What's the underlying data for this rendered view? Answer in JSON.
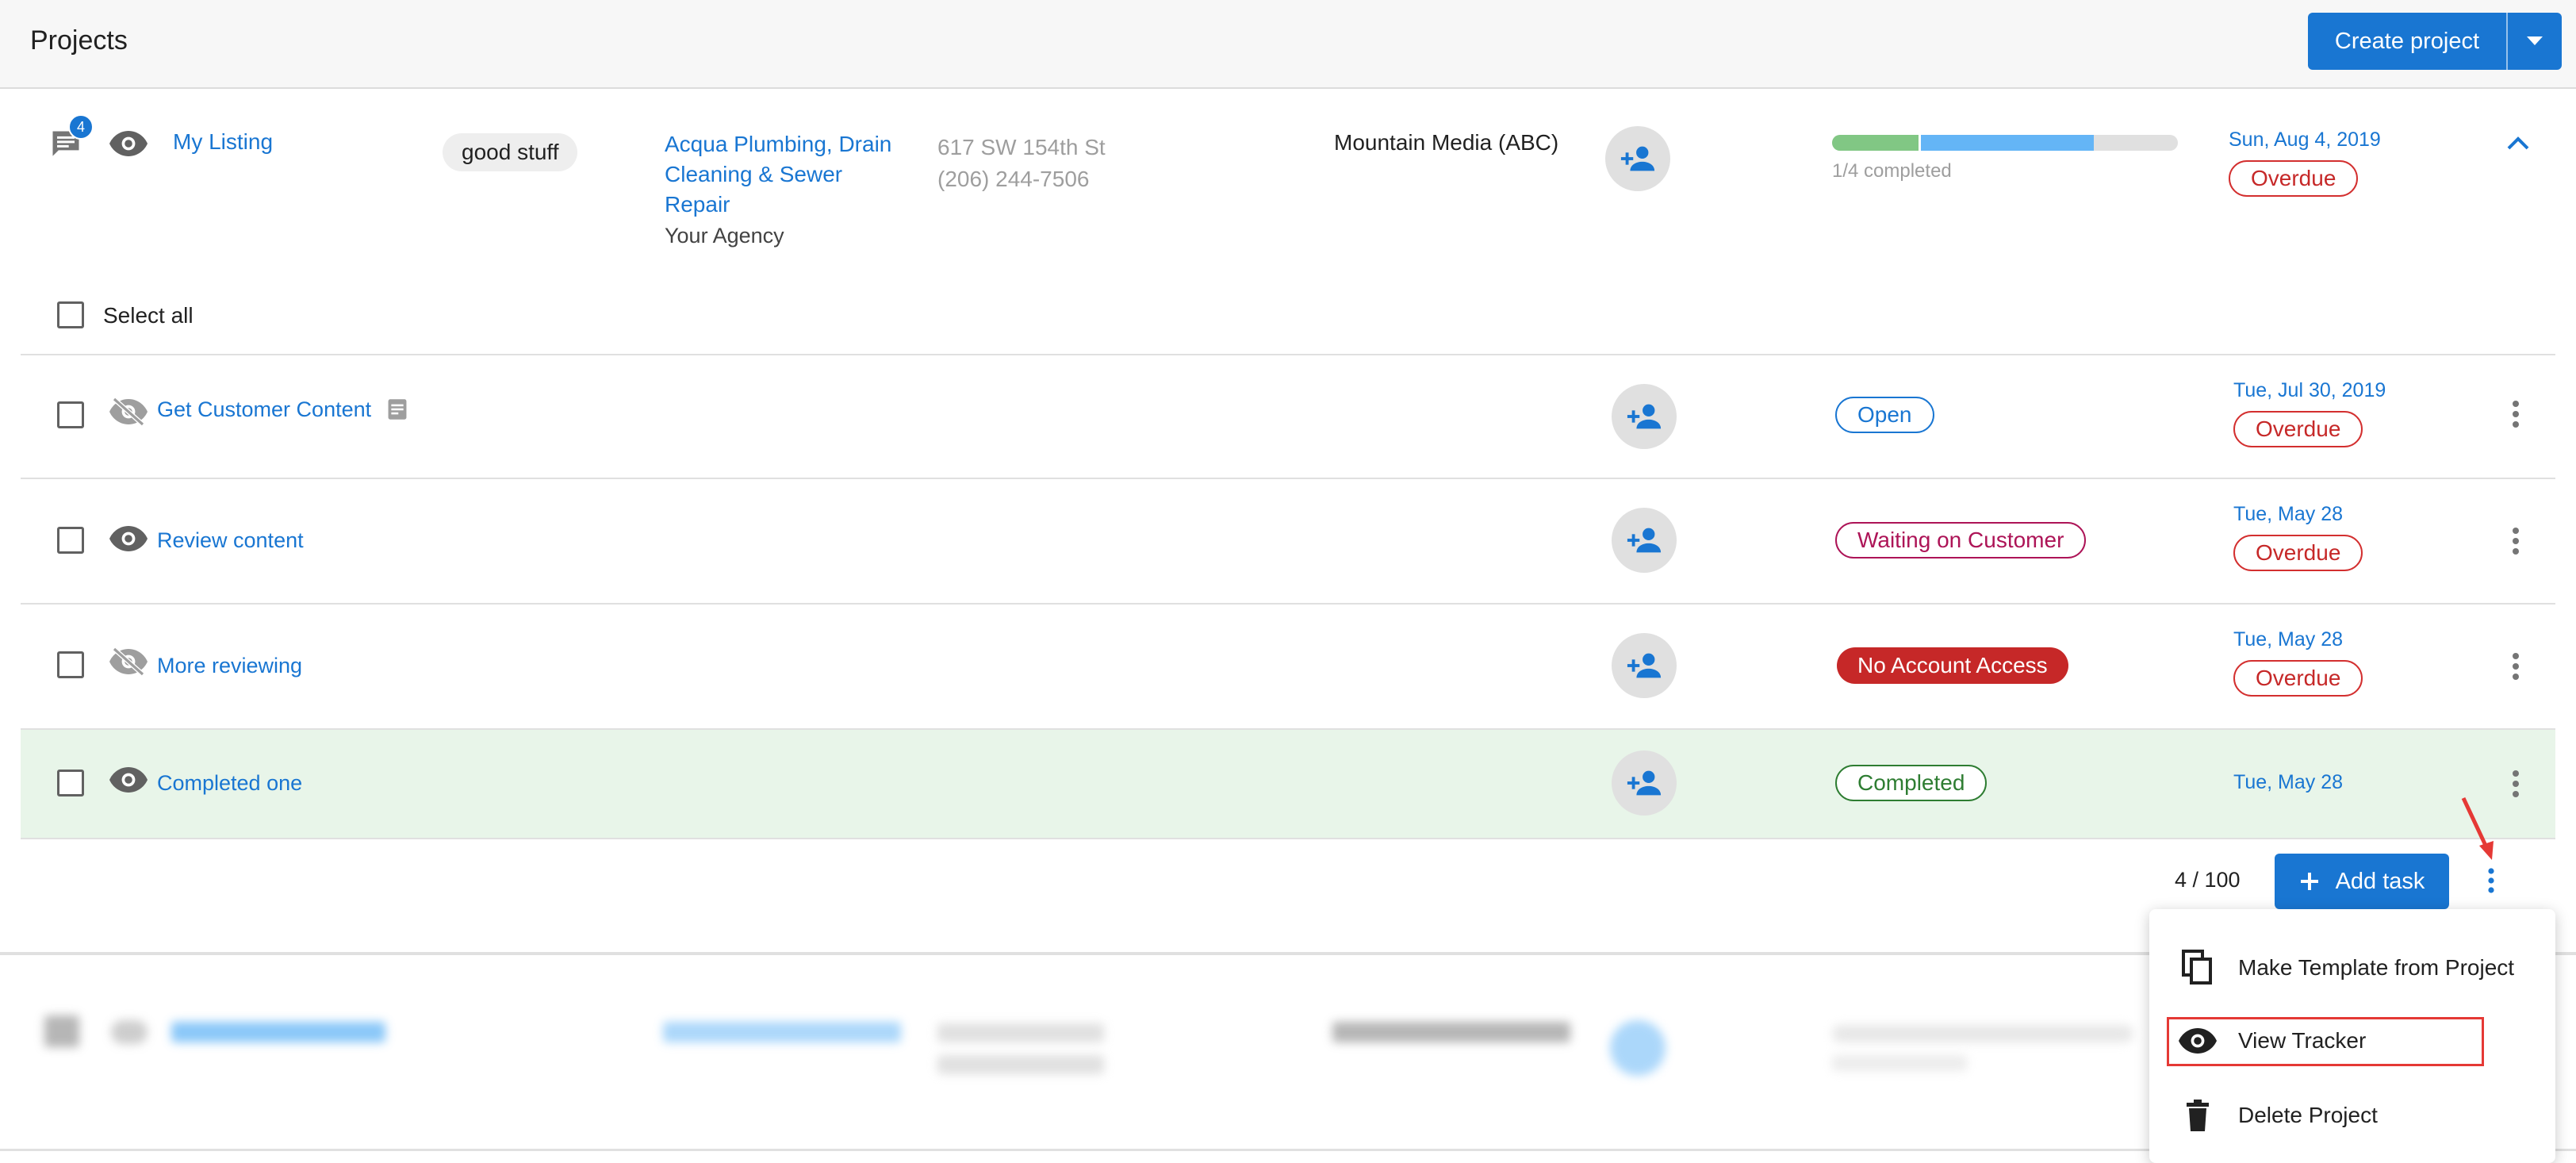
{
  "header": {
    "title": "Projects",
    "create_label": "Create project"
  },
  "project": {
    "badge_count": "4",
    "name": "My Listing",
    "tag": "good stuff",
    "client_line1": "Acqua Plumbing, Drain",
    "client_line2": "Cleaning & Sewer",
    "client_line3": "Repair",
    "agency": "Your Agency",
    "address": "617 SW 154th St",
    "phone": "(206) 244-7506",
    "company": "Mountain Media (ABC)",
    "progress_text": "1/4 completed",
    "progress_completed_fraction": 0.25,
    "progress_inprogress_fraction": 0.5,
    "date": "Sun, Aug 4, 2019",
    "status": "Overdue"
  },
  "select_all_label": "Select all",
  "tasks": [
    {
      "name": "Get Customer Content",
      "status": "Open",
      "date": "Tue, Jul 30, 2019",
      "due": "Overdue"
    },
    {
      "name": "Review content",
      "status": "Waiting on Customer",
      "date": "Tue, May 28",
      "due": "Overdue"
    },
    {
      "name": "More reviewing",
      "status": "No Account Access",
      "date": "Tue, May 28",
      "due": "Overdue"
    },
    {
      "name": "Completed one",
      "status": "Completed",
      "date": "Tue, May 28",
      "due": ""
    }
  ],
  "footer": {
    "count": "4 / 100",
    "add_task_label": "Add task"
  },
  "menu": {
    "items": [
      {
        "label": "Make Template from Project",
        "icon": "copy-icon"
      },
      {
        "label": "View Tracker",
        "icon": "eye-icon"
      },
      {
        "label": "Delete Project",
        "icon": "trash-icon"
      }
    ]
  },
  "colors": {
    "primary": "#1976d2",
    "overdue": "#c62828",
    "completed_row_bg": "#e8f5e9",
    "completed": "#2e7d32",
    "waiting": "#ad1457",
    "annotation": "#e53935"
  }
}
